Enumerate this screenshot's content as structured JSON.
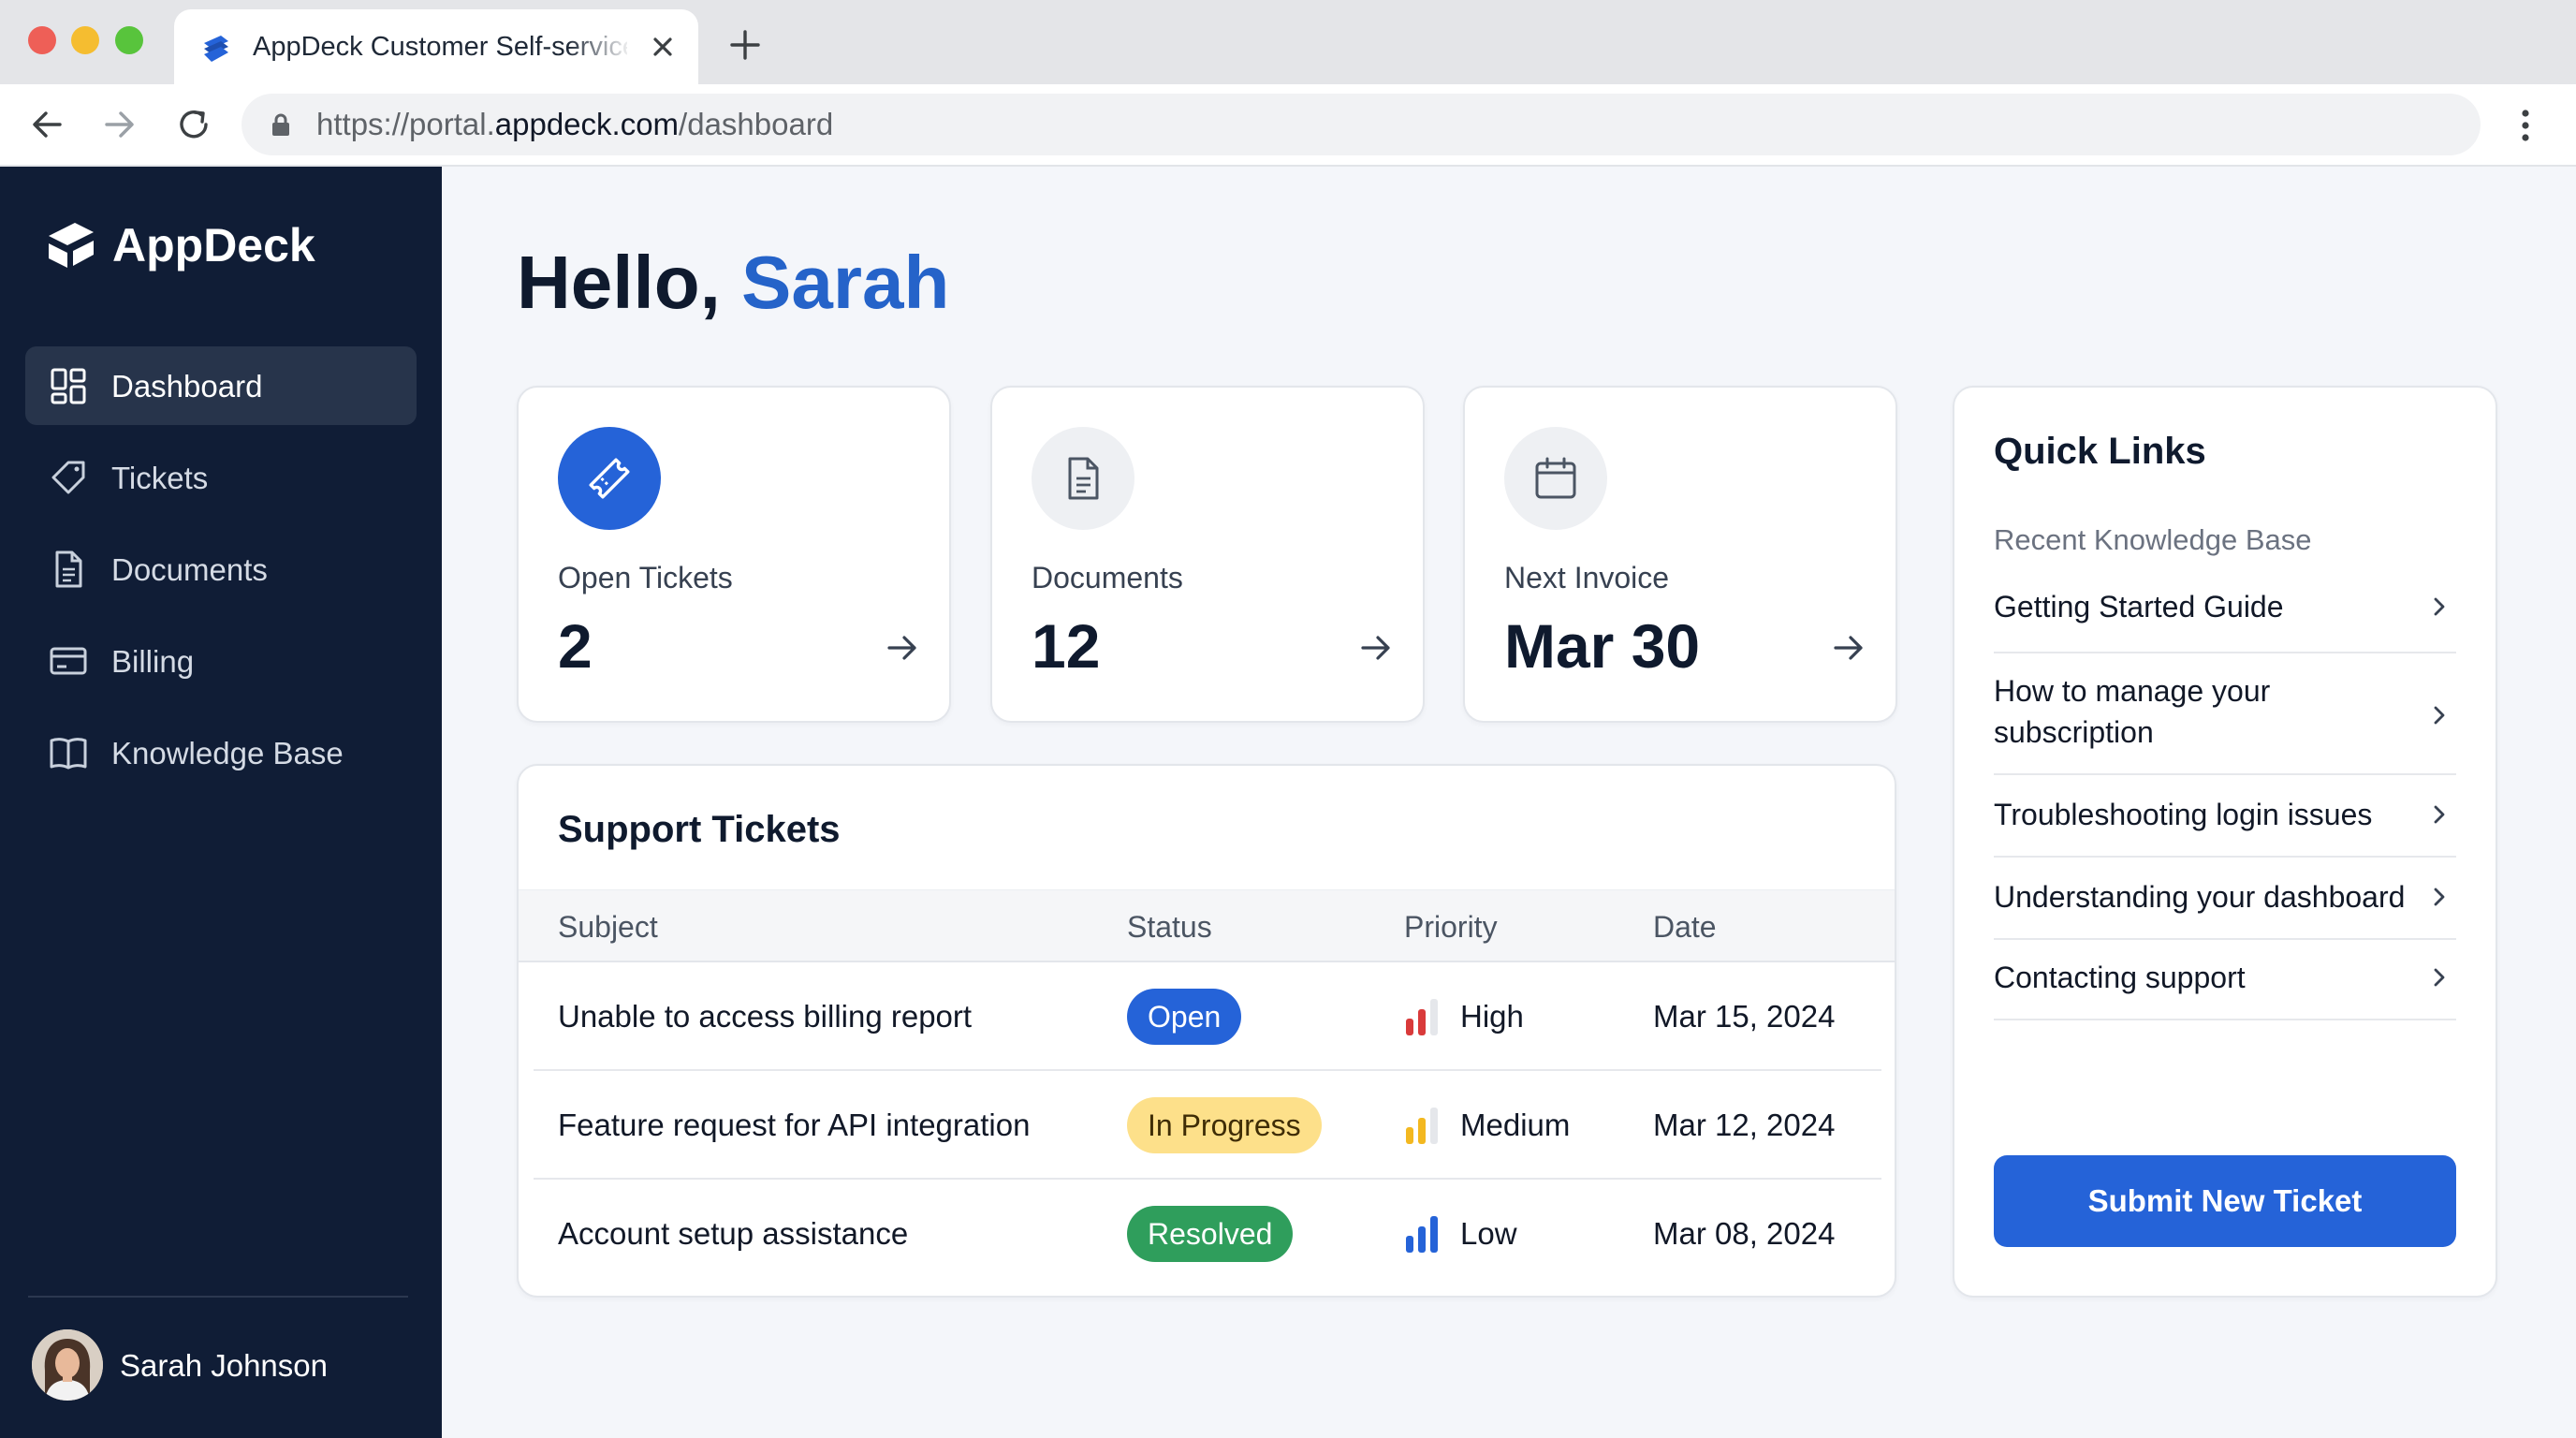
{
  "browser": {
    "tab_title": "AppDeck Customer Self-service Portal",
    "url_scheme": "https://portal.",
    "url_host": "appdeck.com",
    "url_path": "/dashboard"
  },
  "sidebar": {
    "brand": "AppDeck",
    "items": [
      {
        "label": "Dashboard",
        "icon": "dashboard-grid-icon",
        "active": true
      },
      {
        "label": "Tickets",
        "icon": "ticket-icon"
      },
      {
        "label": "Documents",
        "icon": "document-icon"
      },
      {
        "label": "Billing",
        "icon": "credit-card-icon"
      },
      {
        "label": "Knowledge Base",
        "icon": "book-icon"
      }
    ],
    "user_name": "Sarah Johnson"
  },
  "greeting": {
    "prefix": "Hello, ",
    "name": "Sarah"
  },
  "stats": [
    {
      "label": "Open Tickets",
      "value": "2",
      "icon": "ticket-icon"
    },
    {
      "label": "Documents",
      "value": "12",
      "icon": "document-icon"
    },
    {
      "label": "Next Invoice",
      "value": "Mar 30",
      "icon": "calendar-icon"
    }
  ],
  "tickets": {
    "title": "Support Tickets",
    "columns": [
      "Subject",
      "Status",
      "Priority",
      "Date"
    ],
    "rows": [
      {
        "subject": "Unable to access billing report",
        "status": "Open",
        "priority": "High",
        "date": "Mar 15, 2024"
      },
      {
        "subject": "Feature request for API integration",
        "status": "In Progress",
        "priority": "Medium",
        "date": "Mar 12, 2024"
      },
      {
        "subject": "Account setup assistance",
        "status": "Resolved",
        "priority": "Low",
        "date": "Mar 08, 2024"
      }
    ]
  },
  "quick_links": {
    "title": "Quick Links",
    "subtitle": "Recent Knowledge Base",
    "items": [
      "Getting Started Guide",
      "How to manage your subscription",
      "Troubleshooting login issues",
      "Understanding your dashboard",
      "Contacting support"
    ],
    "button": "Submit New Ticket"
  },
  "colors": {
    "accent": "#2563d8",
    "sidebar": "#101d36",
    "priority_high": "#d93a3a",
    "priority_medium": "#f3b820",
    "priority_low": "#2563d8",
    "status_open": "#2563d8",
    "status_in_progress": "#fde08a",
    "status_resolved": "#2f9e5c"
  }
}
